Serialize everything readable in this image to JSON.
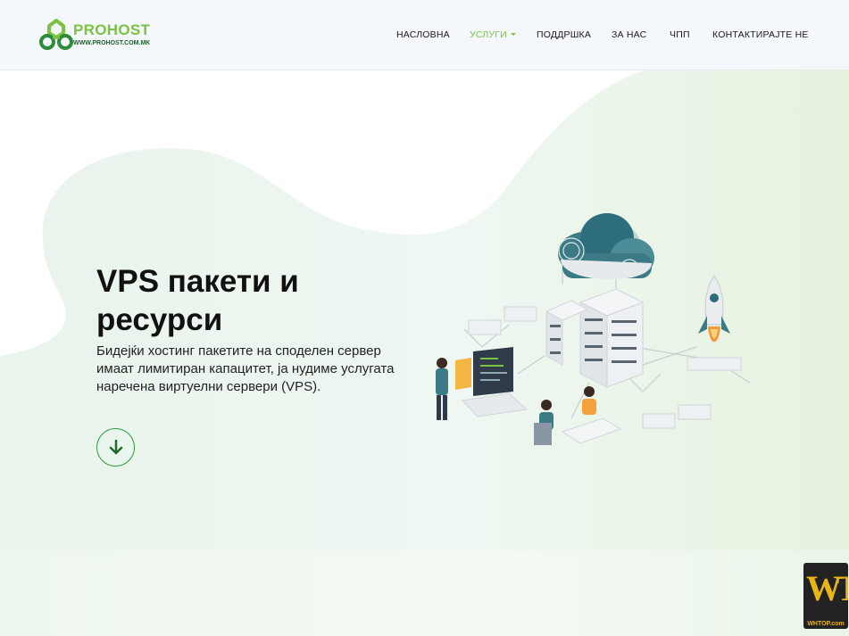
{
  "brand": {
    "name": "PROHOST",
    "url": "WWW.PROHOST.COM.MK"
  },
  "nav": [
    {
      "label": "НАСЛОВНА"
    },
    {
      "label": "УСЛУГИ",
      "active": true,
      "has_dropdown": true
    },
    {
      "label": "ПОДДРШКА"
    },
    {
      "label": "ЗА НАС"
    },
    {
      "label": "ЧПП"
    },
    {
      "label": "КОНТАКТИРАЈТЕ НЕ"
    }
  ],
  "hero": {
    "title": "VPS пакети и ресурси",
    "description": "Бидејќи хостинг пакетите на споделен сервер имаат лимитиран капацитет, ја нудиме услугата наречена виртуелни сервери (VPS).",
    "scroll_icon": "arrow-down-icon"
  },
  "badge": {
    "letters": "WT",
    "caption": "WHTOP.com"
  },
  "colors": {
    "accent": "#7cc242",
    "dark_green": "#2e9a3e",
    "text": "#111111",
    "header_bg": "#f4f8fa"
  }
}
